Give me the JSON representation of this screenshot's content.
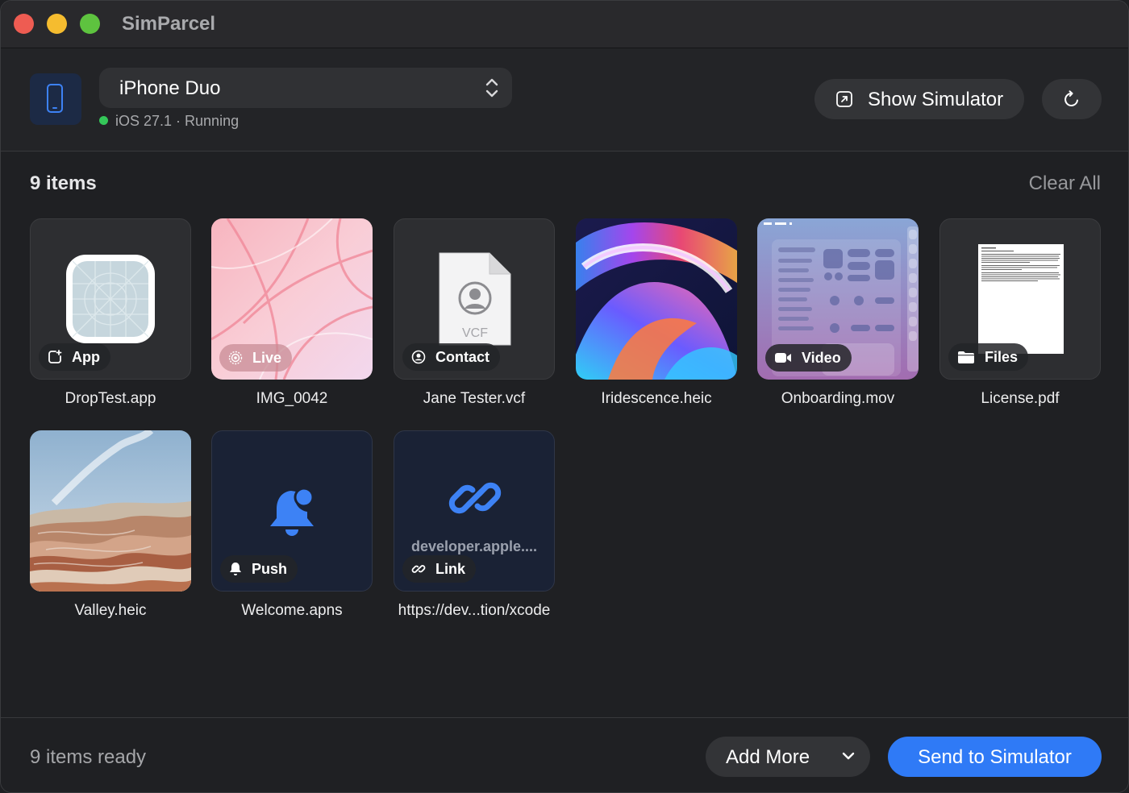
{
  "window": {
    "title": "SimParcel"
  },
  "header": {
    "device_name": "iPhone Duo",
    "device_status": "iOS 27.1 · Running",
    "show_simulator_label": "Show Simulator"
  },
  "items_header": {
    "count_label": "9 items",
    "clear_all_label": "Clear All"
  },
  "items": [
    {
      "badge": "App",
      "caption": "DropTest.app",
      "icon": "app-icon"
    },
    {
      "badge": "Live",
      "caption": "IMG_0042",
      "icon": "live-photo-icon"
    },
    {
      "badge": "Contact",
      "caption": "Jane Tester.vcf",
      "icon": "contact-icon",
      "file_label": "VCF"
    },
    {
      "badge": "",
      "caption": "Iridescence.heic",
      "icon": ""
    },
    {
      "badge": "Video",
      "caption": "Onboarding.mov",
      "icon": "video-icon"
    },
    {
      "badge": "Files",
      "caption": "License.pdf",
      "icon": "folder-icon"
    },
    {
      "badge": "",
      "caption": "Valley.heic",
      "icon": ""
    },
    {
      "badge": "Push",
      "caption": "Welcome.apns",
      "icon": "bell-icon"
    },
    {
      "badge": "Link",
      "caption": "https://dev...tion/xcode",
      "icon": "link-icon",
      "preview_text": "developer.apple...."
    }
  ],
  "footer": {
    "ready_label": "9 items ready",
    "add_more_label": "Add More",
    "send_label": "Send to Simulator"
  },
  "colors": {
    "accent": "#2f7af6",
    "running": "#34c759",
    "push_blue": "#3d82f5"
  }
}
